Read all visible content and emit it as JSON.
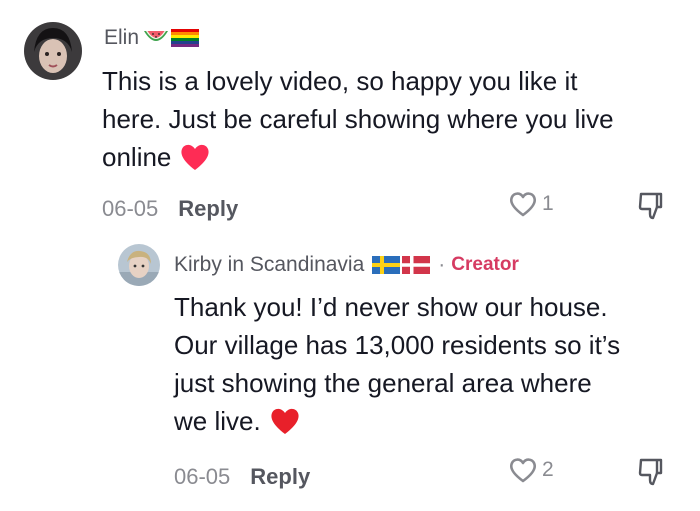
{
  "comments": [
    {
      "author": "Elin",
      "author_badges": [
        "watermelon-emoji",
        "rainbow-flag-emoji"
      ],
      "text_lines": [
        "This is a lovely video, so happy you like it",
        "here. Just be careful showing where you live",
        "online"
      ],
      "emoji": "red-heart-emoji",
      "date": "06-05",
      "reply_label": "Reply",
      "like_count": "1"
    },
    {
      "author": "Kirby in Scandinavia",
      "author_badges": [
        "sweden-flag-emoji",
        "denmark-flag-emoji"
      ],
      "separator": "·",
      "creator_label": "Creator",
      "text_lines": [
        "Thank you! I’d never show our house.",
        "Our village has 13,000 residents so it’s",
        "just showing the general area where",
        "we live."
      ],
      "emoji": "red-heart-emoji",
      "date": "06-05",
      "reply_label": "Reply",
      "like_count": "2"
    }
  ],
  "colors": {
    "accent_creator": "#d63b62",
    "heart": "#fe2c55",
    "muted": "#8a8b91"
  }
}
